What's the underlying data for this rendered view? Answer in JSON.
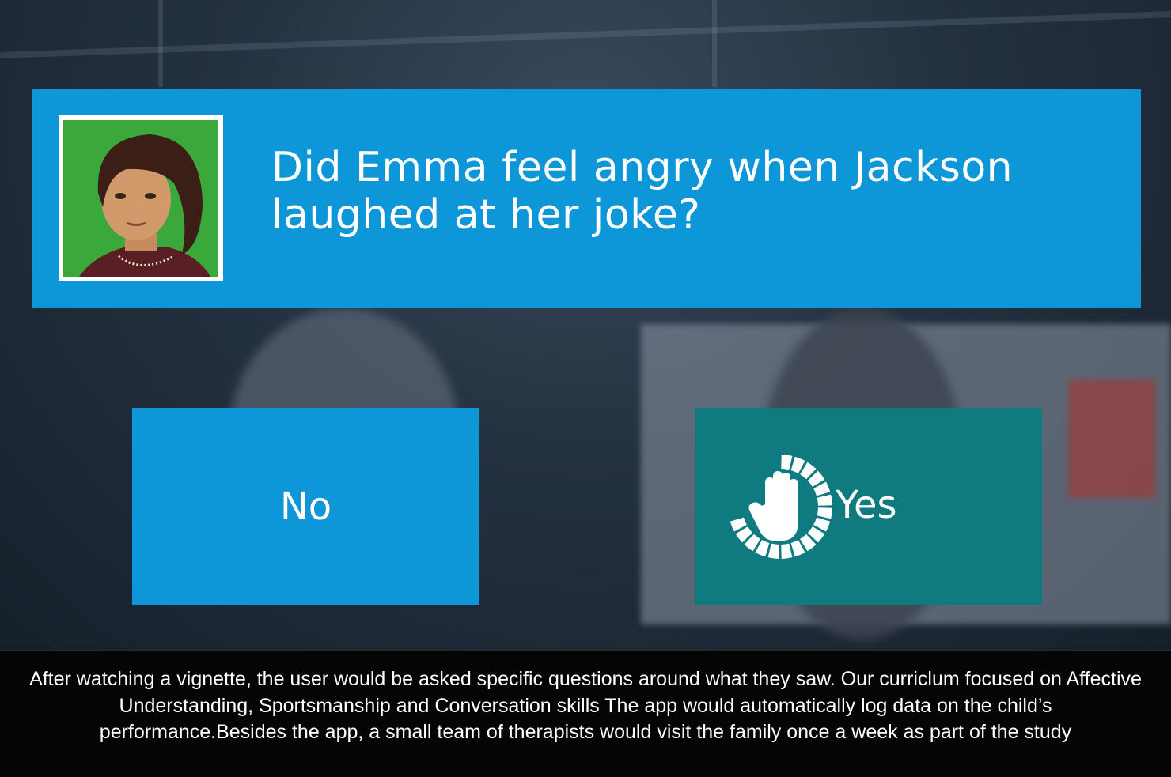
{
  "question": {
    "text": "Did Emma feel angry when Jackson laughed at her joke?",
    "avatar_icon": "emma-avatar-icon"
  },
  "answers": {
    "no_label": "No",
    "yes_label": "Yes",
    "yes_selection_progress": 0.7,
    "hand_cursor_icon": "hand-cursor-icon"
  },
  "colors": {
    "panel_blue": "#0d96d8",
    "yes_teal": "#0f7a7f",
    "avatar_bg": "#3aa83a"
  },
  "caption": {
    "text": "After watching a vignette, the user would be asked specific questions around what they saw.  Our curriclum focused on Affective Understanding, Sportsmanship and Conversation skills The app would automatically log data on the child’s performance.Besides the app, a small team of therapists would visit the family once a week as part of the study"
  }
}
